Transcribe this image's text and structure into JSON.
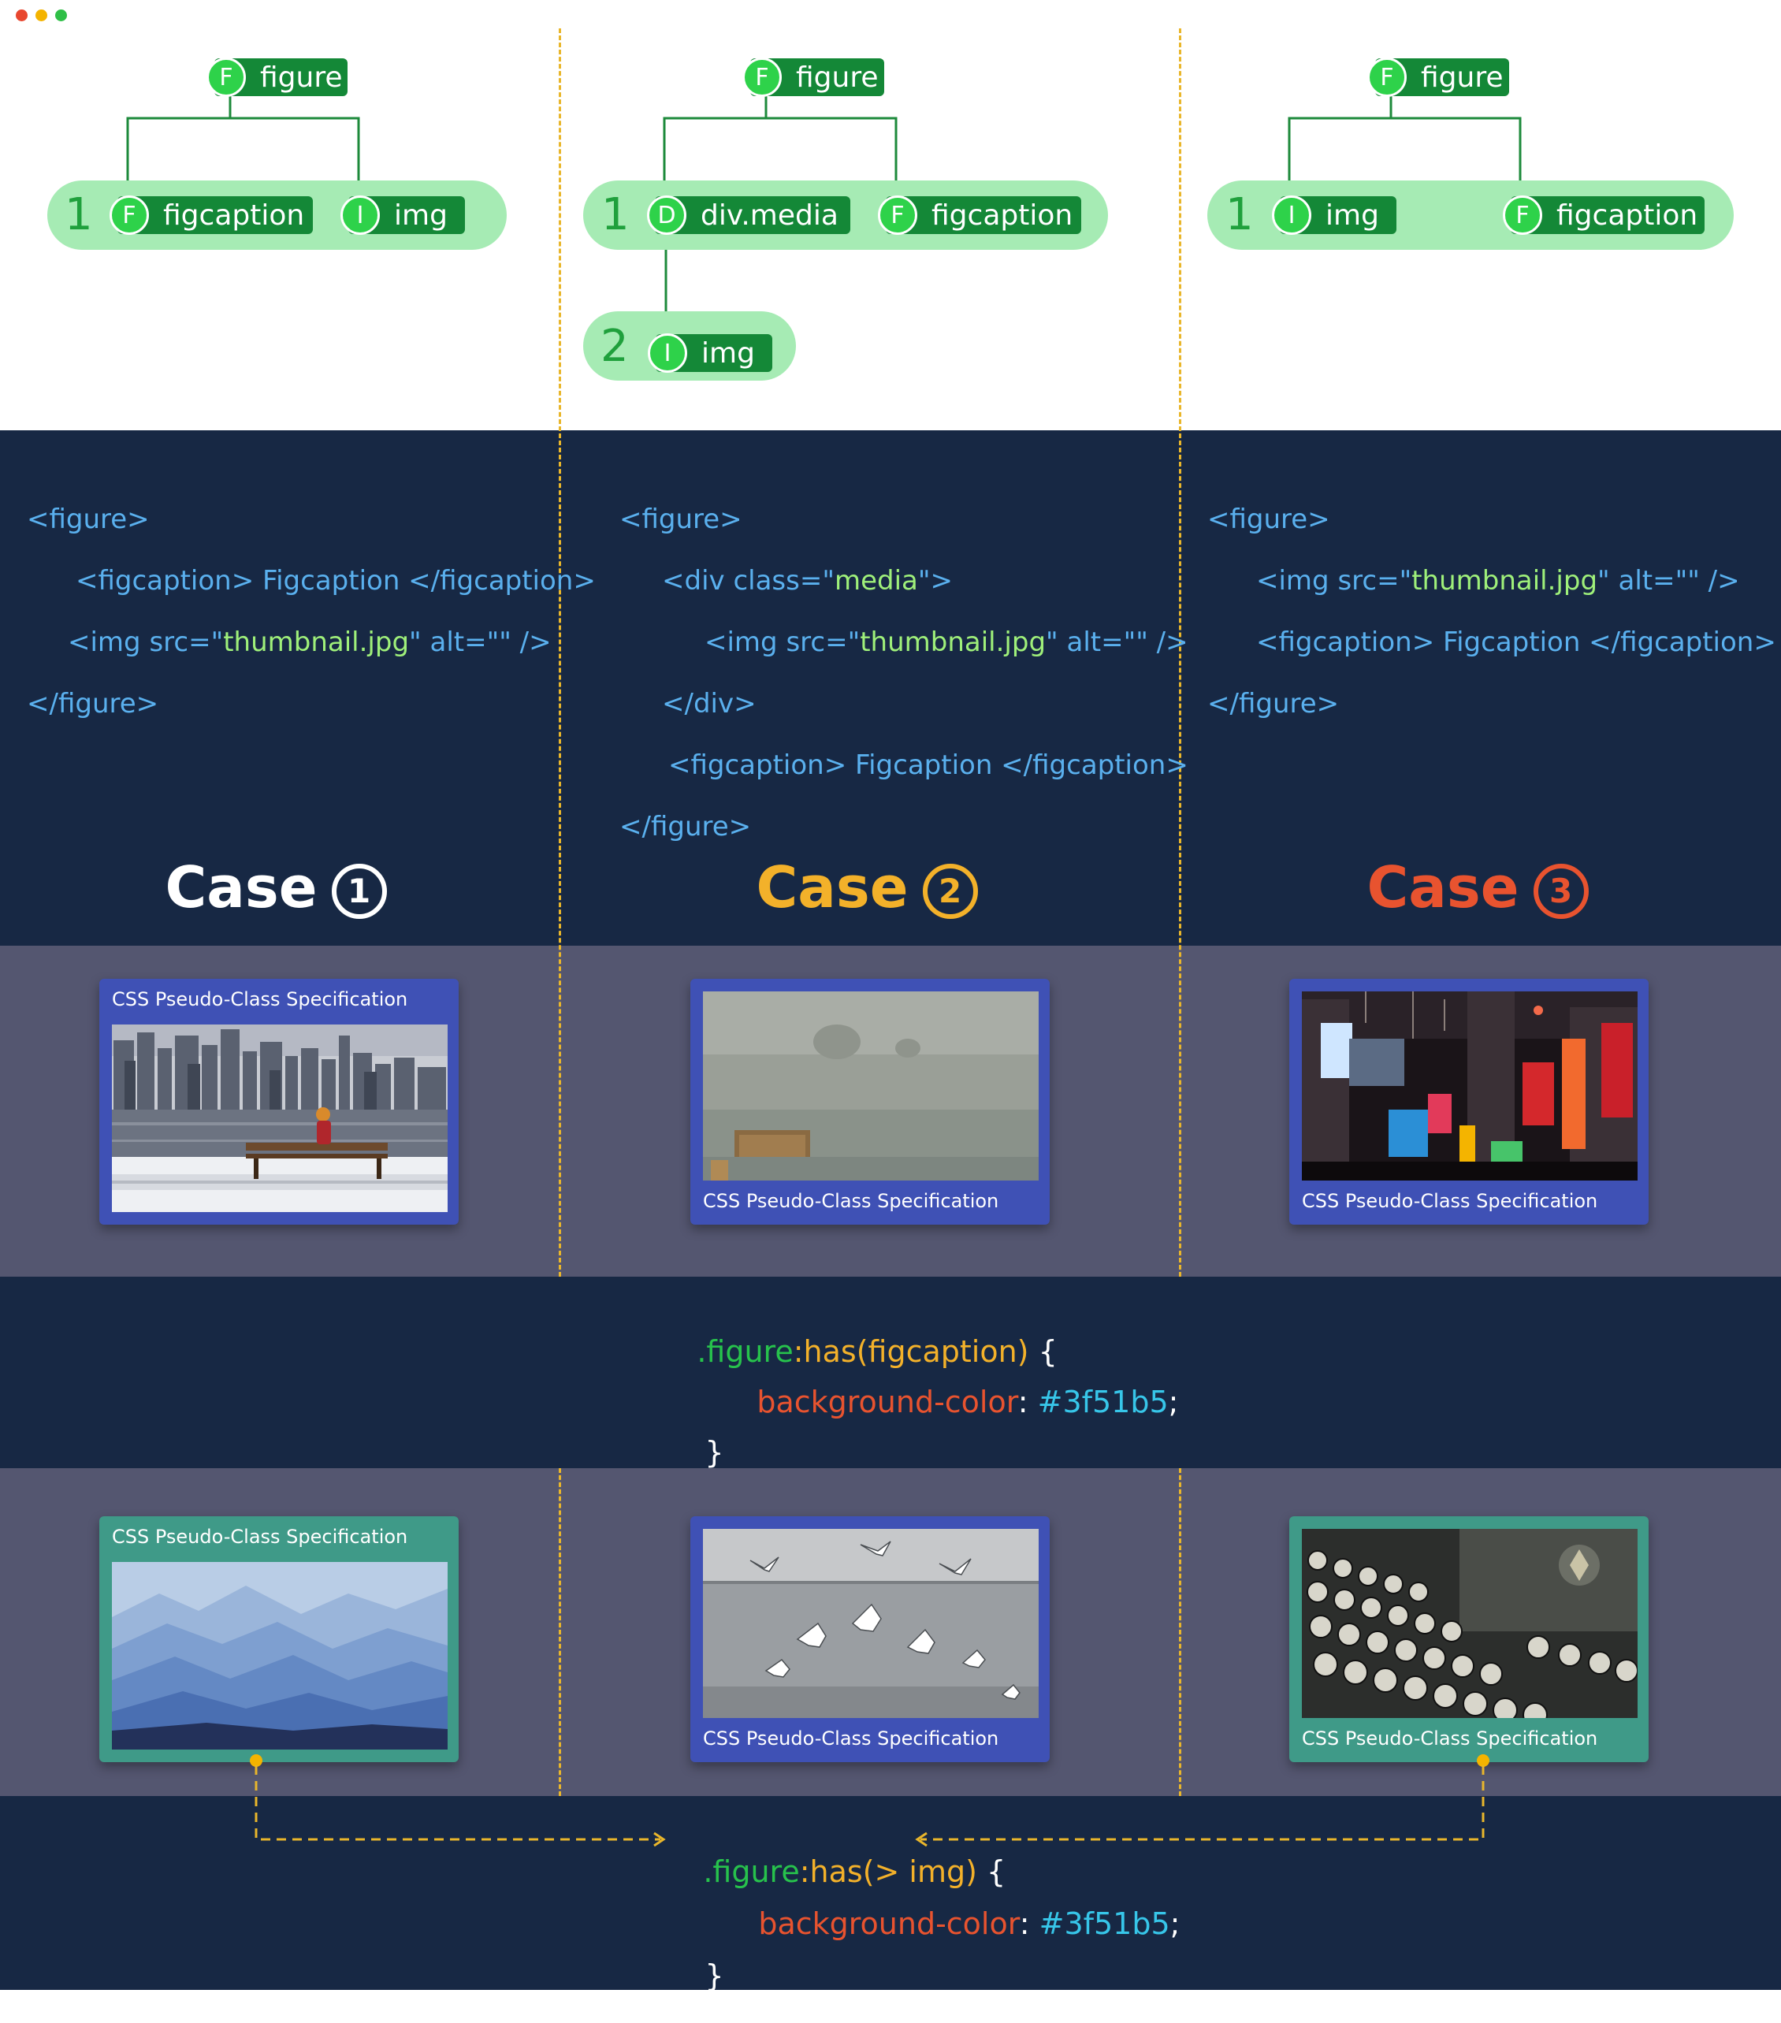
{
  "window": {
    "dots": [
      "#e8472f",
      "#f4b400",
      "#2fbf47"
    ]
  },
  "tree": {
    "case1": {
      "root": {
        "badge": "F",
        "label": "figure"
      },
      "levels": [
        "1"
      ],
      "row1": [
        {
          "badge": "F",
          "label": "figcaption"
        },
        {
          "badge": "I",
          "label": "img"
        }
      ]
    },
    "case2": {
      "root": {
        "badge": "F",
        "label": "figure"
      },
      "levels": [
        "1",
        "2"
      ],
      "row1": [
        {
          "badge": "D",
          "label": "div.media"
        },
        {
          "badge": "F",
          "label": "figcaption"
        }
      ],
      "row2": [
        {
          "badge": "I",
          "label": "img"
        }
      ]
    },
    "case3": {
      "root": {
        "badge": "F",
        "label": "figure"
      },
      "levels": [
        "1"
      ],
      "row1": [
        {
          "badge": "I",
          "label": "img"
        },
        {
          "badge": "F",
          "label": "figcaption"
        }
      ]
    }
  },
  "code": {
    "case1": {
      "l1": "<figure>",
      "l2": "<figcaption> Figcaption </figcaption>",
      "l3a": "<img src=\"",
      "l3s": "thumbnail.jpg",
      "l3b": "\" alt=\"\" />",
      "l4": "</figure>"
    },
    "case2": {
      "l1": "<figure>",
      "l2a": "<div class=\"",
      "l2s": "media",
      "l2b": "\">",
      "l3a": "<img src=\"",
      "l3s": "thumbnail.jpg",
      "l3b": "\" alt=\"\" />",
      "l4": "</div>",
      "l5": "<figcaption> Figcaption </figcaption>",
      "l6": "</figure>"
    },
    "case3": {
      "l1": "<figure>",
      "l2a": "<img src=\"",
      "l2s": "thumbnail.jpg",
      "l2b": "\" alt=\"\" />",
      "l3": "<figcaption> Figcaption </figcaption>",
      "l4": "</figure>"
    }
  },
  "cases": [
    {
      "word": "Case",
      "num": "1",
      "color": "#ffffff"
    },
    {
      "word": "Case",
      "num": "2",
      "color": "#f3b12a"
    },
    {
      "word": "Case",
      "num": "3",
      "color": "#e8532f"
    }
  ],
  "demo1": {
    "card_color": "#3f51b5",
    "caption": "CSS Pseudo-Class Specification",
    "photos": [
      "city-skyline-bench-photo",
      "foggy-shore-photo",
      "neon-street-night-photo"
    ]
  },
  "css1": {
    "selector": ".figure",
    "pseudo": ":has(figcaption)",
    "brace_open": " {",
    "property": "background-color",
    "colon": ":",
    "value": "#3f51b5",
    "semi": ";",
    "brace_close": "}"
  },
  "demo2": {
    "card_color_matched": "#3f9a88",
    "card_color_default": "#3f51b5",
    "caption": "CSS Pseudo-Class Specification",
    "photos": [
      "misty-mountains-photo",
      "seagulls-photo",
      "typewriter-keys-photo"
    ]
  },
  "css2": {
    "selector": ".figure",
    "pseudo": ":has(> img)",
    "brace_open": " {",
    "property": "background-color",
    "colon": ":",
    "value": "#3f51b5",
    "semi": ";",
    "brace_close": "}"
  }
}
